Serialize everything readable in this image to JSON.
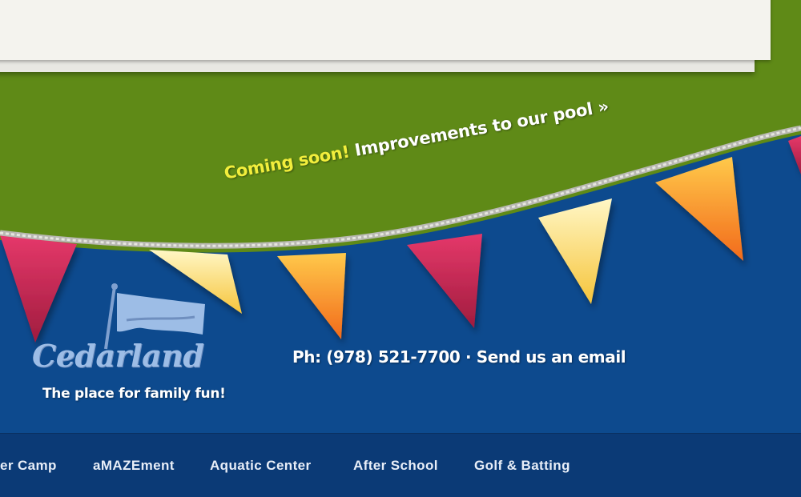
{
  "promo": {
    "highlight": "Coming soon!",
    "text": "Improvements to our pool",
    "arrow": "»"
  },
  "brand": {
    "name": "Cedarland",
    "tagline": "The place for family fun!"
  },
  "contact": {
    "phone": "Ph: (978) 521-7700",
    "separator": "·",
    "email_link": "Send us an email"
  },
  "nav": {
    "items": [
      {
        "label": "er Camp"
      },
      {
        "label": "aMAZEment"
      },
      {
        "label": "Aquatic Center"
      },
      {
        "label": "After School"
      },
      {
        "label": "Golf & Batting"
      }
    ]
  },
  "colors": {
    "green": "#5f8a17",
    "blue": "#0d4a8e",
    "nav": "#0b3a76",
    "highlight": "#f2ee3c"
  },
  "icons": [
    "flag-logo-icon",
    "pennant-banner"
  ]
}
